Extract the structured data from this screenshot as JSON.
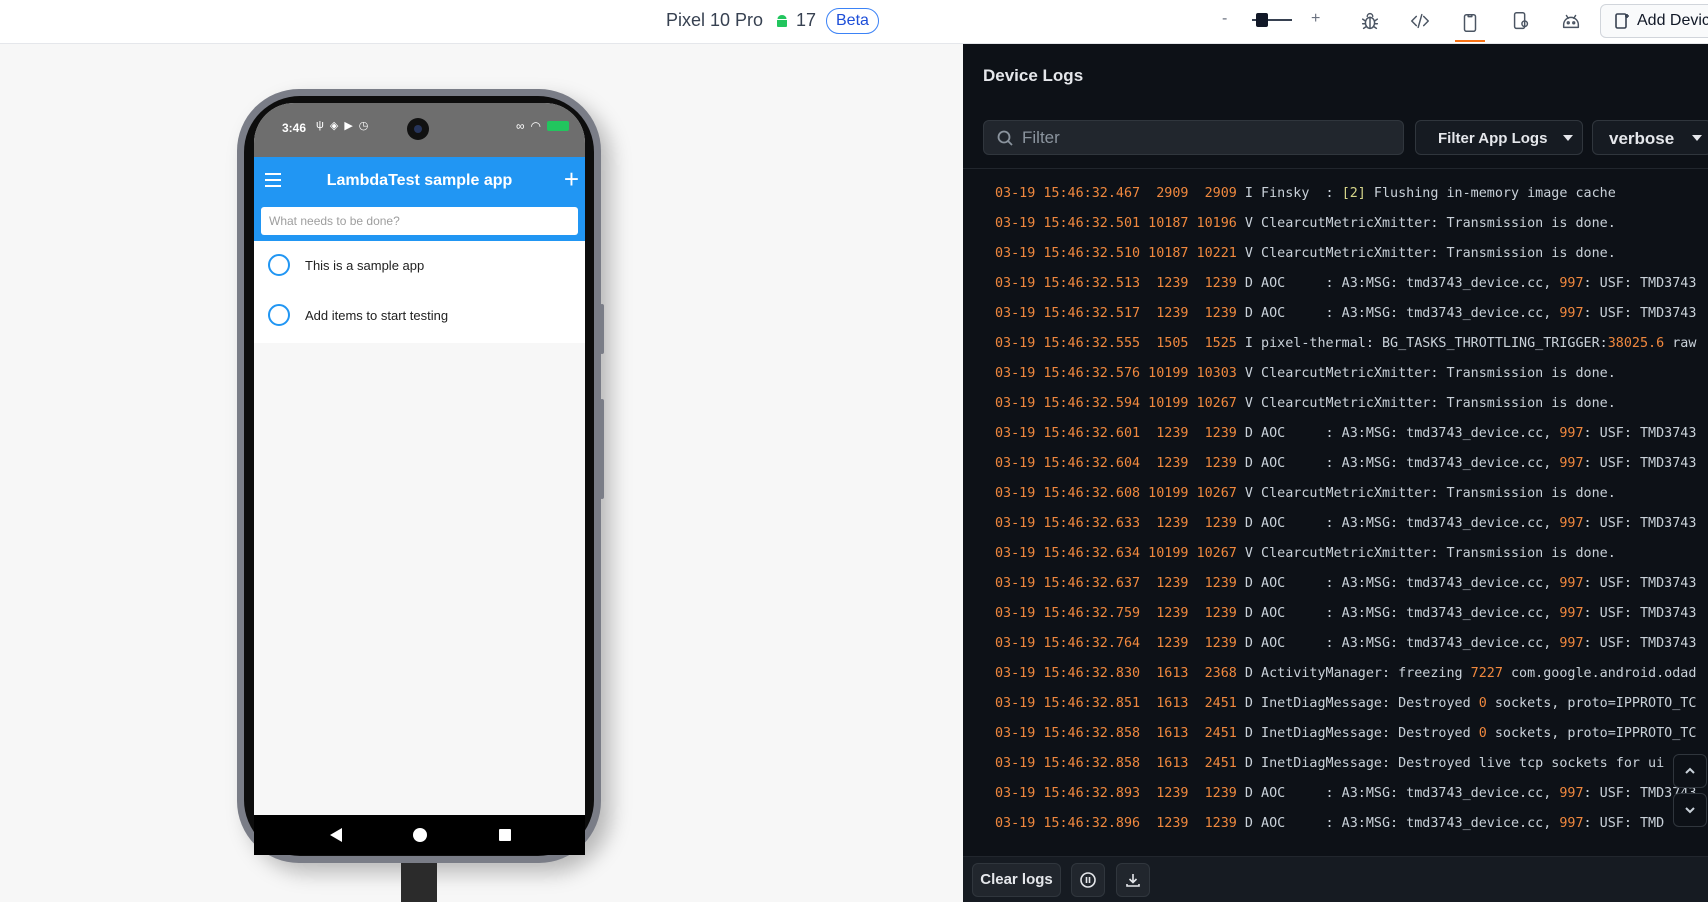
{
  "toolbar": {
    "device_name": "Pixel 10 Pro",
    "android_version": "17",
    "beta_badge": "Beta",
    "zoom_minus": "-",
    "zoom_plus": "+",
    "add_device_label": "Add Device",
    "active_tab_color": "#f97316",
    "icons": [
      "bug-icon",
      "code-icon",
      "device-icon",
      "device-rotate-icon",
      "android-robot-icon"
    ]
  },
  "phone": {
    "status_time": "3:46",
    "app_title": "LambdaTest sample app",
    "add_symbol": "+",
    "input_placeholder": "What needs to be done?",
    "items": [
      {
        "label": "This is a sample app"
      },
      {
        "label": "Add items to start testing"
      }
    ],
    "appbar_color": "#2196f3"
  },
  "logs": {
    "title": "Device Logs",
    "filter_placeholder": "Filter",
    "app_filter_label": "Filter App Logs",
    "level_label": "verbose",
    "clear_label": "Clear logs",
    "lines": [
      {
        "ts": "03-19 15:46:32.467",
        "pid": "2909",
        "tid": "2909",
        "lvl": "I",
        "tag": "Finsky  :",
        "pre": " ",
        "hl": "[2]",
        "post": " Flushing in-memory image cache",
        "hl_color": "yellow"
      },
      {
        "ts": "03-19 15:46:32.501",
        "pid": "10187",
        "tid": "10196",
        "lvl": "V",
        "tag": "ClearcutMetricXmitter:",
        "pre": " Transmission is done.",
        "hl": "",
        "post": ""
      },
      {
        "ts": "03-19 15:46:32.510",
        "pid": "10187",
        "tid": "10221",
        "lvl": "V",
        "tag": "ClearcutMetricXmitter:",
        "pre": " Transmission is done.",
        "hl": "",
        "post": ""
      },
      {
        "ts": "03-19 15:46:32.513",
        "pid": "1239",
        "tid": "1239",
        "lvl": "D",
        "tag": "AOC     :",
        "pre": " A3:MSG: tmd3743_device.cc, ",
        "hl": "997",
        "post": ": USF: TMD3743"
      },
      {
        "ts": "03-19 15:46:32.517",
        "pid": "1239",
        "tid": "1239",
        "lvl": "D",
        "tag": "AOC     :",
        "pre": " A3:MSG: tmd3743_device.cc, ",
        "hl": "997",
        "post": ": USF: TMD3743"
      },
      {
        "ts": "03-19 15:46:32.555",
        "pid": "1505",
        "tid": "1525",
        "lvl": "I",
        "tag": "pixel-thermal:",
        "pre": " BG_TASKS_THROTTLING_TRIGGER:",
        "hl": "38025.6",
        "post": " raw"
      },
      {
        "ts": "03-19 15:46:32.576",
        "pid": "10199",
        "tid": "10303",
        "lvl": "V",
        "tag": "ClearcutMetricXmitter:",
        "pre": " Transmission is done.",
        "hl": "",
        "post": ""
      },
      {
        "ts": "03-19 15:46:32.594",
        "pid": "10199",
        "tid": "10267",
        "lvl": "V",
        "tag": "ClearcutMetricXmitter:",
        "pre": " Transmission is done.",
        "hl": "",
        "post": ""
      },
      {
        "ts": "03-19 15:46:32.601",
        "pid": "1239",
        "tid": "1239",
        "lvl": "D",
        "tag": "AOC     :",
        "pre": " A3:MSG: tmd3743_device.cc, ",
        "hl": "997",
        "post": ": USF: TMD3743"
      },
      {
        "ts": "03-19 15:46:32.604",
        "pid": "1239",
        "tid": "1239",
        "lvl": "D",
        "tag": "AOC     :",
        "pre": " A3:MSG: tmd3743_device.cc, ",
        "hl": "997",
        "post": ": USF: TMD3743"
      },
      {
        "ts": "03-19 15:46:32.608",
        "pid": "10199",
        "tid": "10267",
        "lvl": "V",
        "tag": "ClearcutMetricXmitter:",
        "pre": " Transmission is done.",
        "hl": "",
        "post": ""
      },
      {
        "ts": "03-19 15:46:32.633",
        "pid": "1239",
        "tid": "1239",
        "lvl": "D",
        "tag": "AOC     :",
        "pre": " A3:MSG: tmd3743_device.cc, ",
        "hl": "997",
        "post": ": USF: TMD3743"
      },
      {
        "ts": "03-19 15:46:32.634",
        "pid": "10199",
        "tid": "10267",
        "lvl": "V",
        "tag": "ClearcutMetricXmitter:",
        "pre": " Transmission is done.",
        "hl": "",
        "post": ""
      },
      {
        "ts": "03-19 15:46:32.637",
        "pid": "1239",
        "tid": "1239",
        "lvl": "D",
        "tag": "AOC     :",
        "pre": " A3:MSG: tmd3743_device.cc, ",
        "hl": "997",
        "post": ": USF: TMD3743"
      },
      {
        "ts": "03-19 15:46:32.759",
        "pid": "1239",
        "tid": "1239",
        "lvl": "D",
        "tag": "AOC     :",
        "pre": " A3:MSG: tmd3743_device.cc, ",
        "hl": "997",
        "post": ": USF: TMD3743"
      },
      {
        "ts": "03-19 15:46:32.764",
        "pid": "1239",
        "tid": "1239",
        "lvl": "D",
        "tag": "AOC     :",
        "pre": " A3:MSG: tmd3743_device.cc, ",
        "hl": "997",
        "post": ": USF: TMD3743"
      },
      {
        "ts": "03-19 15:46:32.830",
        "pid": "1613",
        "tid": "2368",
        "lvl": "D",
        "tag": "ActivityManager:",
        "pre": " freezing ",
        "hl": "7227",
        "post": " com.google.android.odad"
      },
      {
        "ts": "03-19 15:46:32.851",
        "pid": "1613",
        "tid": "2451",
        "lvl": "D",
        "tag": "InetDiagMessage:",
        "pre": " Destroyed ",
        "hl": "0",
        "post": " sockets, proto=IPPROTO_TC"
      },
      {
        "ts": "03-19 15:46:32.858",
        "pid": "1613",
        "tid": "2451",
        "lvl": "D",
        "tag": "InetDiagMessage:",
        "pre": " Destroyed ",
        "hl": "0",
        "post": " sockets, proto=IPPROTO_TC"
      },
      {
        "ts": "03-19 15:46:32.858",
        "pid": "1613",
        "tid": "2451",
        "lvl": "D",
        "tag": "InetDiagMessage:",
        "pre": " Destroyed live tcp sockets for ui",
        "hl": "",
        "post": ""
      },
      {
        "ts": "03-19 15:46:32.893",
        "pid": "1239",
        "tid": "1239",
        "lvl": "D",
        "tag": "AOC     :",
        "pre": " A3:MSG: tmd3743_device.cc, ",
        "hl": "997",
        "post": ": USF: TMD3743"
      },
      {
        "ts": "03-19 15:46:32.896",
        "pid": "1239",
        "tid": "1239",
        "lvl": "D",
        "tag": "AOC     :",
        "pre": " A3:MSG: tmd3743_device.cc, ",
        "hl": "997",
        "post": ": USF: TMD"
      }
    ]
  }
}
